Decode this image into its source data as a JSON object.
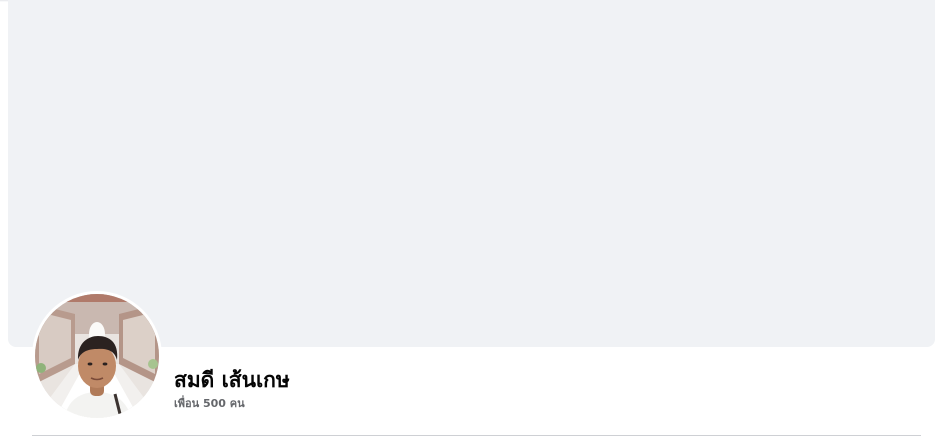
{
  "profile": {
    "name": "สมดี เส้นเกษ",
    "friends_count": "เพื่อน 500 คน"
  },
  "colors": {
    "cover_background": "#f0f2f5",
    "name_text": "#050505",
    "secondary_text": "#65676b",
    "divider": "#ced0d4"
  },
  "icons": {
    "avatar": "profile-photo"
  }
}
